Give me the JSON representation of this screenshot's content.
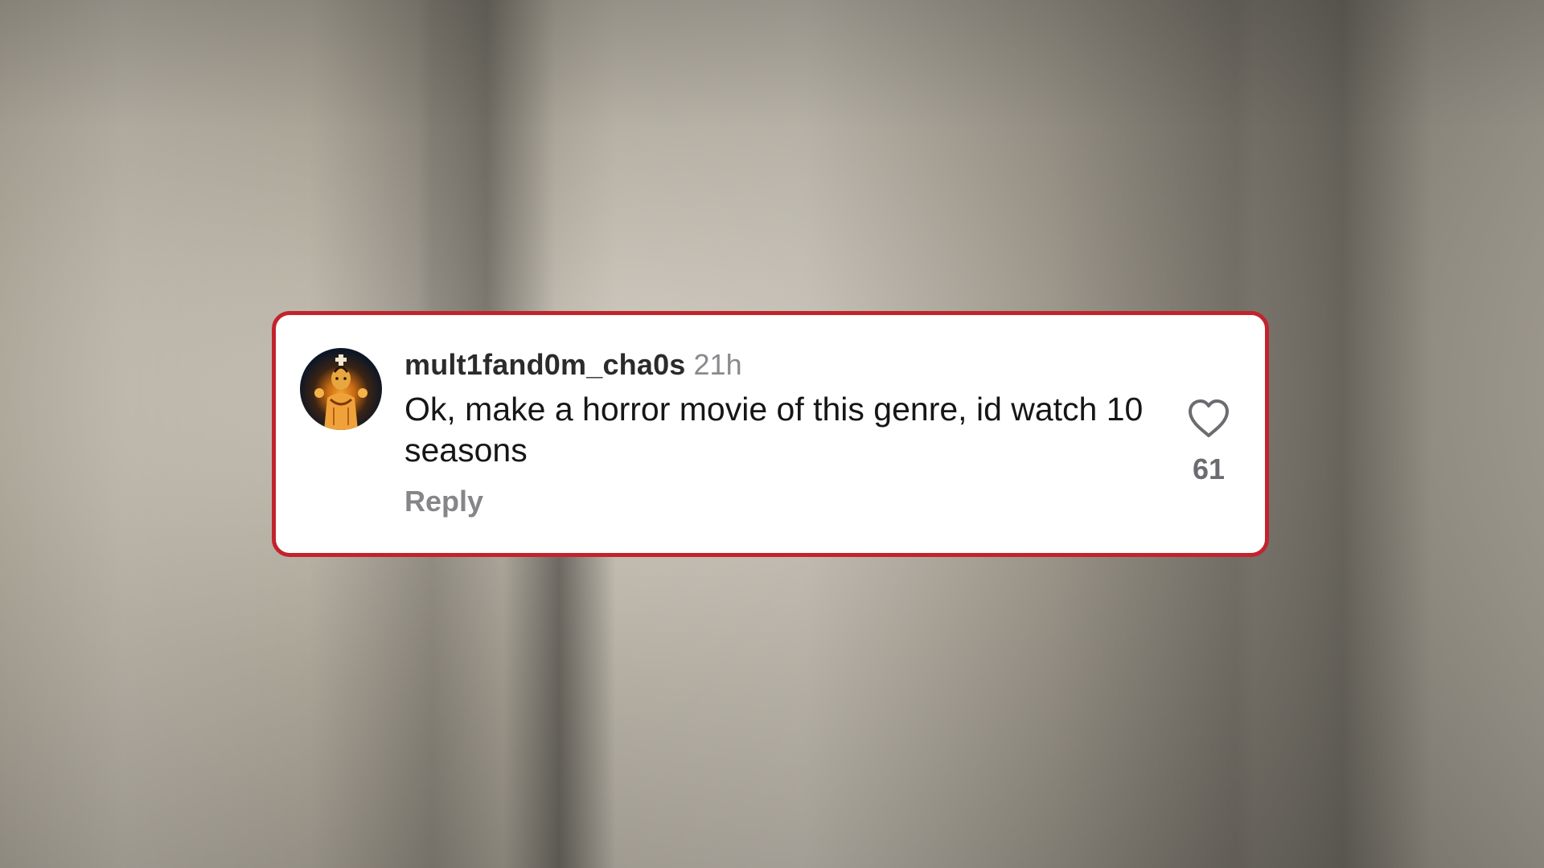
{
  "comment": {
    "username": "mult1fand0m_cha0s",
    "timestamp": "21h",
    "text": "Ok, make a horror movie of this genre, id watch 10 seasons",
    "reply_label": "Reply",
    "like_count": "61",
    "like_icon": "heart-outline-icon",
    "avatar_icon": "user-avatar"
  },
  "colors": {
    "card_border": "#c3232c",
    "card_background": "#ffffff",
    "username": "#2b2b2b",
    "muted_text": "#8a8a8e",
    "body_text": "#161616"
  }
}
